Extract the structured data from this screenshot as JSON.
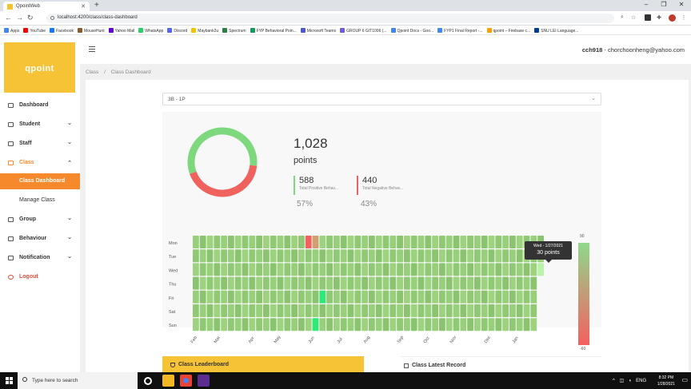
{
  "browser": {
    "tab_title": "QpointWeb",
    "url": "localhost:4200/class/class-dashboard",
    "bookmarks": [
      "Apps",
      "YouTube",
      "Facebook",
      "MouseHunt",
      "Yahoo Mail",
      "WhatsApp",
      "Discord",
      "Maybank2u",
      "Spectrum",
      "FYP Behavioral Poin...",
      "Microsoft Teams",
      "GROUP 6 GIT1006 (...",
      "Qpoint Docs - Goo...",
      "FYP1 Final Report -...",
      "qpoint – Firebase c...",
      "SNU LEI Language..."
    ],
    "bookmark_colors": [
      "#4285f4",
      "#ff0000",
      "#1877f2",
      "#8b5a2b",
      "#6001d2",
      "#25d366",
      "#5865f2",
      "#f5c400",
      "#2d7d46",
      "#0f9d58",
      "#5059c9",
      "#6c5ce7",
      "#4285f4",
      "#4285f4",
      "#ffa000",
      "#003c8f"
    ]
  },
  "app": {
    "logo": "qpoint",
    "user_name": "cch918",
    "user_email": "chorchoonheng@yahoo.com",
    "accent": "#f5892b",
    "brand_yellow": "#f6c236"
  },
  "sidebar": {
    "items": [
      {
        "label": "Dashboard",
        "icon": "bar-chart-icon"
      },
      {
        "label": "Student",
        "icon": "user-icon"
      },
      {
        "label": "Staff",
        "icon": "staff-icon"
      },
      {
        "label": "Class",
        "icon": "class-icon"
      },
      {
        "label": "Class Dashboard"
      },
      {
        "label": "Manage Class"
      },
      {
        "label": "Group",
        "icon": "group-icon"
      },
      {
        "label": "Behaviour",
        "icon": "behaviour-icon"
      },
      {
        "label": "Notification",
        "icon": "notification-icon"
      },
      {
        "label": "Logout",
        "icon": "logout-icon"
      }
    ]
  },
  "breadcrumb": {
    "root": "Class",
    "sep": "/",
    "current": "Class Dashboard"
  },
  "class_select": {
    "value": "3B - 1P"
  },
  "summary": {
    "total": "1,028",
    "total_label": "points",
    "positive": {
      "value": "588",
      "label": "Total Positive Behav...",
      "percent": "57%",
      "color": "#7ed87e"
    },
    "negative": {
      "value": "440",
      "label": "Total Negative Behav...",
      "percent": "43%",
      "color": "#f0625d"
    }
  },
  "heatmap": {
    "days": [
      "Mon",
      "Tue",
      "Wed",
      "Thu",
      "Fri",
      "Sat",
      "Sun"
    ],
    "months": [
      "Feb",
      "Mar",
      "Apr",
      "May",
      "Jun",
      "Jul",
      "Aug",
      "Sep",
      "Oct",
      "Nov",
      "Dec",
      "Jan"
    ],
    "tooltip": {
      "date": "Wed - 1/27/2021",
      "points": "30 points"
    },
    "scale_max": "90",
    "scale_min": "-60"
  },
  "chart_data": {
    "type": "pie",
    "categories": [
      "Total Positive Behav...",
      "Total Negative Behav..."
    ],
    "values": [
      588,
      440
    ],
    "colors": [
      "#7ed87e",
      "#f0625d"
    ]
  },
  "panels": {
    "leaderboard": "Class Leaderboard",
    "latest": "Class Latest Record"
  },
  "taskbar": {
    "search": "Type here to search",
    "lang": "ENG",
    "time": "8:32 PM",
    "date": "1/28/2021"
  }
}
